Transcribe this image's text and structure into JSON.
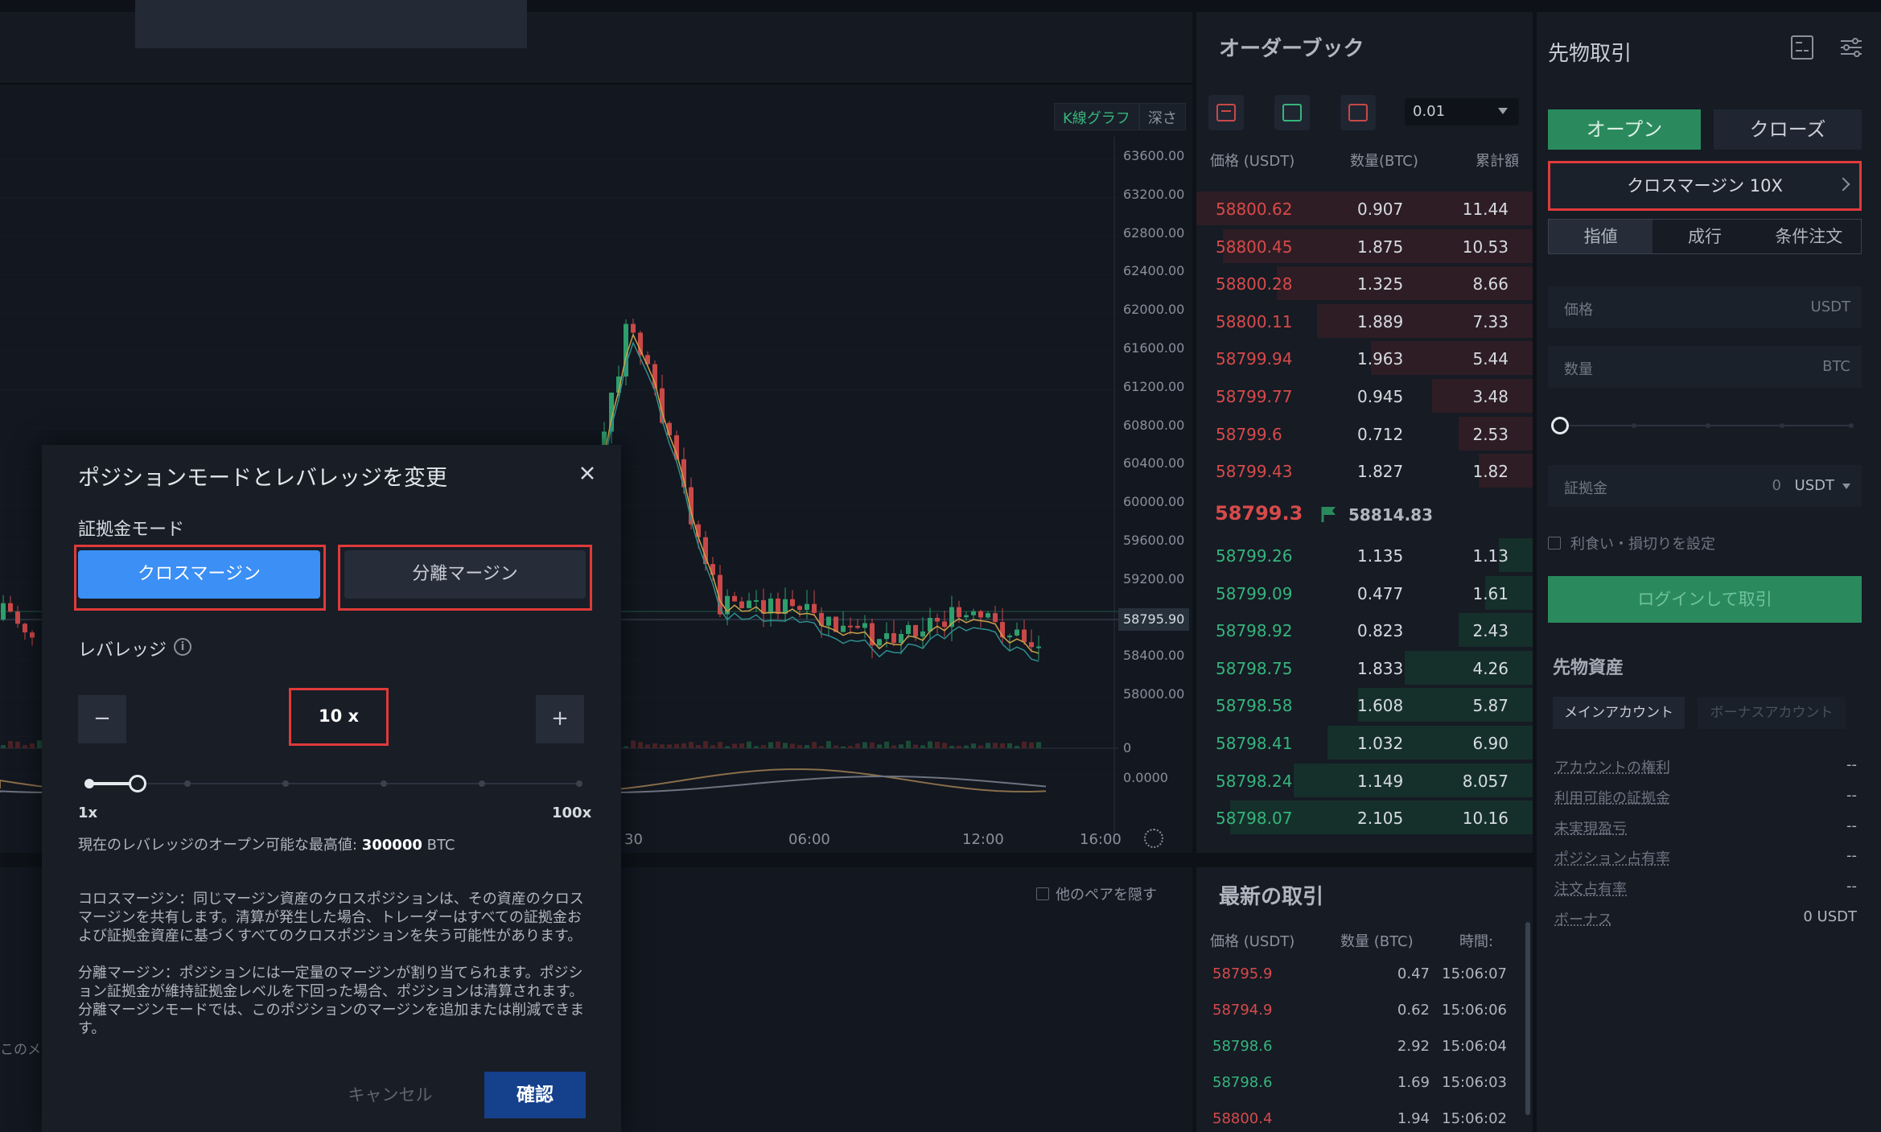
{
  "colors": {
    "ask": "#d74a4a",
    "bid": "#36b47c",
    "accent_blue": "#3b8ff5",
    "accent_green": "#2a8a5d",
    "highlight_red": "#e03a3a"
  },
  "chart": {
    "tabs": [
      "K線グラフ",
      "深さ"
    ],
    "price_ticks": [
      "63600.00",
      "63200.00",
      "62800.00",
      "62400.00",
      "62000.00",
      "61600.00",
      "61200.00",
      "60800.00",
      "60400.00",
      "60000.00",
      "59600.00",
      "59200.00",
      "58800.00",
      "58400.00",
      "58000.00",
      "0",
      "0.0000"
    ],
    "current_price": "58795.90",
    "time_ticks": [
      "30",
      "06:00",
      "12:00",
      "16:00"
    ],
    "hide_pairs_label": "他のペアを隠す",
    "lower_left_fragment": "このメッ"
  },
  "orderbook": {
    "title": "オーダーブック",
    "precision": "0.01",
    "headers": {
      "price": "価格 (USDT)",
      "qty": "数量(BTC)",
      "cum": "累計額"
    },
    "asks": [
      {
        "p": "58800.62",
        "q": "0.907",
        "c": "11.44",
        "depth": 1.0
      },
      {
        "p": "58800.45",
        "q": "1.875",
        "c": "10.53",
        "depth": 0.92
      },
      {
        "p": "58800.28",
        "q": "1.325",
        "c": "8.66",
        "depth": 0.76
      },
      {
        "p": "58800.11",
        "q": "1.889",
        "c": "7.33",
        "depth": 0.64
      },
      {
        "p": "58799.94",
        "q": "1.963",
        "c": "5.44",
        "depth": 0.48
      },
      {
        "p": "58799.77",
        "q": "0.945",
        "c": "3.48",
        "depth": 0.3
      },
      {
        "p": "58799.6",
        "q": "0.712",
        "c": "2.53",
        "depth": 0.22
      },
      {
        "p": "58799.43",
        "q": "1.827",
        "c": "1.82",
        "depth": 0.16
      }
    ],
    "mid_price": "58799.3",
    "mid_ref": "58814.83",
    "bids": [
      {
        "p": "58799.26",
        "q": "1.135",
        "c": "1.13",
        "depth": 0.1
      },
      {
        "p": "58799.09",
        "q": "0.477",
        "c": "1.61",
        "depth": 0.14
      },
      {
        "p": "58798.92",
        "q": "0.823",
        "c": "2.43",
        "depth": 0.22
      },
      {
        "p": "58798.75",
        "q": "1.833",
        "c": "4.26",
        "depth": 0.38
      },
      {
        "p": "58798.58",
        "q": "1.608",
        "c": "5.87",
        "depth": 0.52
      },
      {
        "p": "58798.41",
        "q": "1.032",
        "c": "6.90",
        "depth": 0.61
      },
      {
        "p": "58798.24",
        "q": "1.149",
        "c": "8.057",
        "depth": 0.71
      },
      {
        "p": "58798.07",
        "q": "2.105",
        "c": "10.16",
        "depth": 0.9
      }
    ]
  },
  "latest_trades": {
    "title": "最新の取引",
    "headers": {
      "price": "価格 (USDT)",
      "qty": "数量 (BTC)",
      "time": "時間:"
    },
    "rows": [
      {
        "p": "58795.9",
        "q": "0.47",
        "t": "15:06:07",
        "side": "sell"
      },
      {
        "p": "58794.9",
        "q": "0.62",
        "t": "15:06:06",
        "side": "sell"
      },
      {
        "p": "58798.6",
        "q": "2.92",
        "t": "15:06:04",
        "side": "buy"
      },
      {
        "p": "58798.6",
        "q": "1.69",
        "t": "15:06:03",
        "side": "buy"
      },
      {
        "p": "58800.4",
        "q": "1.94",
        "t": "15:06:02",
        "side": "sell"
      }
    ]
  },
  "futures": {
    "title": "先物取引",
    "open_label": "オープン",
    "close_label": "クローズ",
    "margin_mode_label": "クロスマージン 10X",
    "order_types": [
      "指値",
      "成行",
      "条件注文"
    ],
    "price_label": "価格",
    "price_unit": "USDT",
    "qty_label": "数量",
    "qty_unit": "BTC",
    "margin_label": "証拠金",
    "margin_value": "0",
    "margin_unit": "USDT",
    "tpsl_label": "利食い・損切りを設定",
    "login_button": "ログインして取引",
    "assets_title": "先物資産",
    "main_account": "メインアカウント",
    "bonus_account": "ボーナスアカウント",
    "asset_rows": [
      {
        "l": "アカウントの権利",
        "r": "--"
      },
      {
        "l": "利用可能の証拠金",
        "r": "--"
      },
      {
        "l": "未実現盈亏",
        "r": "--"
      },
      {
        "l": "ポジション占有率",
        "r": "--"
      },
      {
        "l": "注文占有率",
        "r": "--"
      },
      {
        "l": "ボーナス",
        "r": "0 USDT"
      }
    ]
  },
  "modal": {
    "title": "ポジションモードとレバレッジを変更",
    "margin_mode_label": "証拠金モード",
    "cross_label": "クロスマージン",
    "isolated_label": "分離マージン",
    "leverage_label": "レバレッジ",
    "info_glyph": "i",
    "minus": "−",
    "plus": "+",
    "leverage_value": "10 x",
    "leverage_fraction": 0.1,
    "min_label": "1x",
    "max_label": "100x",
    "max_open_prefix": "現在のレバレッジのオープン可能な最高値:",
    "max_open_value": "300000",
    "max_open_unit": "BTC",
    "cross_desc": "コロスマージン：同じマージン資産のクロスポジションは、その資産のクロスマージンを共有します。清算が発生した場合、トレーダーはすべての証拠金および証拠金資産に基づくすべてのクロスポジションを失う可能性があります。",
    "isolated_desc": "分離マージン：ポジションには一定量のマージンが割り当てられます。ポジション証拠金が維持証拠金レベルを下回った場合、ポジションは清算されます。分離マージンモードでは、このポジションのマージンを追加または削減できます。",
    "cancel_label": "キャンセル",
    "confirm_label": "確認"
  }
}
